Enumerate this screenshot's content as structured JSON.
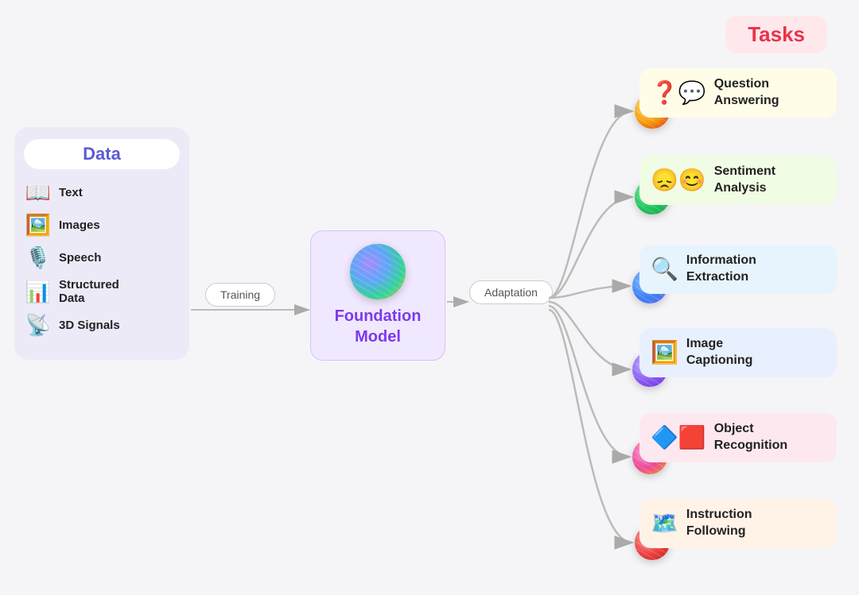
{
  "data_section": {
    "title": "Data",
    "items": [
      {
        "id": "text",
        "label": "Text",
        "icon": "📖"
      },
      {
        "id": "images",
        "label": "Images",
        "icon": "🖼️"
      },
      {
        "id": "speech",
        "label": "Speech",
        "icon": "🎤"
      },
      {
        "id": "structured",
        "label": "Structured Data",
        "icon": "📊"
      },
      {
        "id": "3d",
        "label": "3D Signals",
        "icon": "📡"
      }
    ]
  },
  "training_label": "Training",
  "foundation_model_label": "Foundation\nModel",
  "adaptation_label": "Adaptation",
  "tasks_title": "Tasks",
  "tasks": [
    {
      "id": "qa",
      "label": "Question\nAnswering",
      "bg": "#fffde7",
      "icon": "💬",
      "sphere_class": "sphere-yellow"
    },
    {
      "id": "sentiment",
      "label": "Sentiment\nAnalysis",
      "bg": "#f0fce4",
      "icon": "😊",
      "sphere_class": "sphere-green"
    },
    {
      "id": "ie",
      "label": "Information\nExtraction",
      "bg": "#e8f4fd",
      "icon": "🔍",
      "sphere_class": "sphere-blue"
    },
    {
      "id": "ic",
      "label": "Image\nCaptioning",
      "bg": "#e8f0ff",
      "icon": "🖼️",
      "sphere_class": "sphere-purple"
    },
    {
      "id": "or",
      "label": "Object\nRecognition",
      "bg": "#fde8f0",
      "icon": "🔷",
      "sphere_class": "sphere-pink"
    },
    {
      "id": "if",
      "label": "Instruction\nFollowing",
      "bg": "#fff3e8",
      "icon": "🗺️",
      "sphere_class": "sphere-red"
    }
  ]
}
